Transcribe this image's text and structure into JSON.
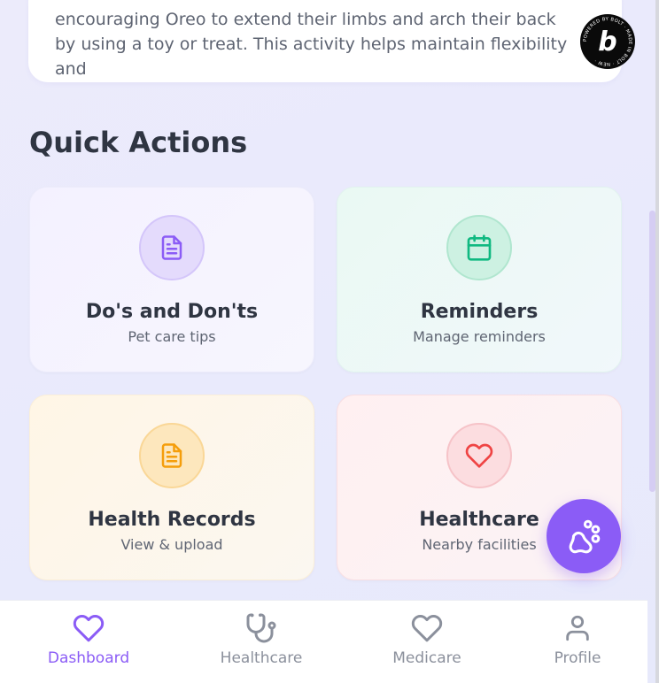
{
  "top_card": {
    "text": "encouraging Oreo to extend their limbs and arch their back by using a toy or treat. This activity helps maintain flexibility and"
  },
  "badge": {
    "letter": "b",
    "ring_text": "POWERED BY BOLT · MADE IN BOLT · NEW ·"
  },
  "quick_actions": {
    "title": "Quick Actions",
    "cards": [
      {
        "title": "Do's and Don'ts",
        "subtitle": "Pet care tips",
        "icon": "document-icon",
        "accent": "#8b5cf6"
      },
      {
        "title": "Reminders",
        "subtitle": "Manage reminders",
        "icon": "calendar-icon",
        "accent": "#10b981"
      },
      {
        "title": "Health Records",
        "subtitle": "View & upload",
        "icon": "file-text-icon",
        "accent": "#f59e0b"
      },
      {
        "title": "Healthcare",
        "subtitle": "Nearby facilities",
        "icon": "heart-icon",
        "accent": "#ef4444"
      }
    ]
  },
  "fab": {
    "icon": "paw-icon",
    "color": "#8b5cf6"
  },
  "bottom_nav": {
    "items": [
      {
        "label": "Dashboard",
        "icon": "heart-icon",
        "active": true
      },
      {
        "label": "Healthcare",
        "icon": "stethoscope-icon",
        "active": false
      },
      {
        "label": "Medicare",
        "icon": "heart-icon",
        "active": false
      },
      {
        "label": "Profile",
        "icon": "user-icon",
        "active": false
      }
    ],
    "active_color": "#8b5cf6",
    "inactive_color": "#8b909c"
  }
}
